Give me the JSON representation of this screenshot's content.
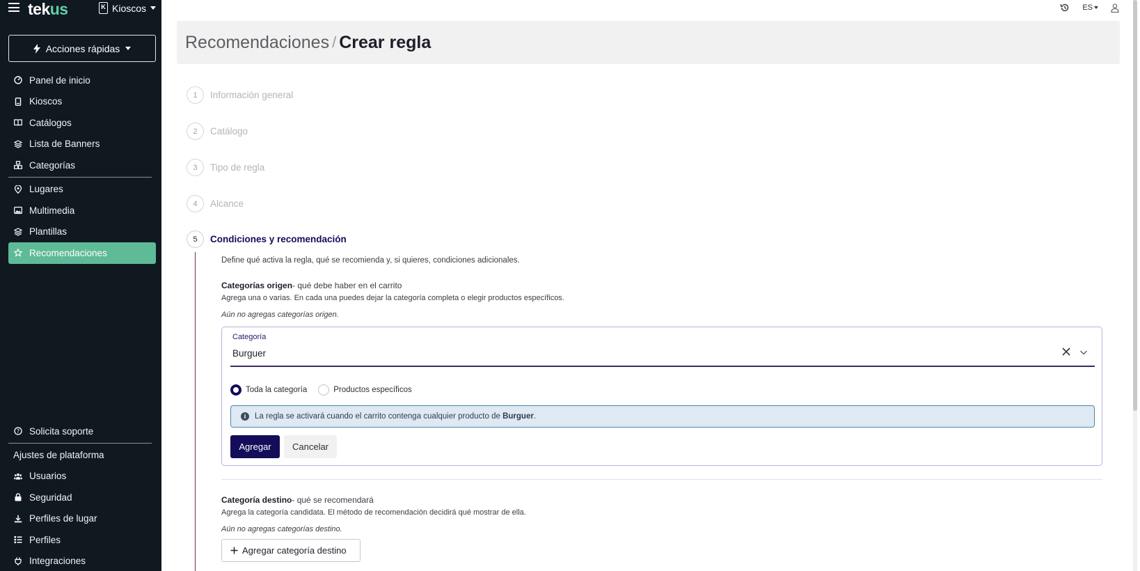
{
  "app": {
    "logo_text_a": "tek",
    "logo_text_b": "us",
    "kiosk_selector": "Kioscos",
    "quick_actions": "Acciones rápidas"
  },
  "sidebar": {
    "items_top": [
      {
        "label": "Panel de inicio",
        "icon": "dashboard-icon"
      },
      {
        "label": "Kioscos",
        "icon": "kiosk-icon"
      },
      {
        "label": "Catálogos",
        "icon": "book-icon"
      },
      {
        "label": "Lista de Banners",
        "icon": "layers-icon"
      },
      {
        "label": "Categorías",
        "icon": "category-icon"
      }
    ],
    "items_mid": [
      {
        "label": "Lugares",
        "icon": "pin-icon"
      },
      {
        "label": "Multimedia",
        "icon": "image-icon"
      },
      {
        "label": "Plantillas",
        "icon": "layers-icon"
      },
      {
        "label": "Recomendaciones",
        "icon": "star-icon",
        "active": true
      }
    ],
    "support": "Solicita soporte",
    "settings_title": "Ajustes de plataforma",
    "items_settings": [
      {
        "label": "Usuarios",
        "icon": "users-icon"
      },
      {
        "label": "Seguridad",
        "icon": "lock-icon"
      },
      {
        "label": "Perfiles de lugar",
        "icon": "anchor-icon"
      },
      {
        "label": "Perfiles",
        "icon": "list-icon"
      },
      {
        "label": "Integraciones",
        "icon": "plug-icon"
      }
    ]
  },
  "topbar": {
    "language": "ES"
  },
  "header": {
    "breadcrumb_parent": "Recomendaciones",
    "separator": "/",
    "breadcrumb_current": "Crear regla"
  },
  "steps": [
    {
      "num": "1",
      "label": "Información general"
    },
    {
      "num": "2",
      "label": "Catálogo"
    },
    {
      "num": "3",
      "label": "Tipo de regla"
    },
    {
      "num": "4",
      "label": "Alcance"
    },
    {
      "num": "5",
      "label": "Condiciones y recomendación",
      "active": true
    }
  ],
  "step5": {
    "description": "Define qué activa la regla, qué se recomienda y, si quieres, condiciones adicionales.",
    "origin_title": "Categorías origen",
    "origin_subtitle": "- qué debe haber en el carrito",
    "origin_help": "Agrega una o varias. En cada una puedes dejar la categoría completa o elegir productos específicos.",
    "origin_empty": "Aún no agregas categorías origen.",
    "form": {
      "field_label": "Categoría",
      "field_value": "Burguer",
      "radio_all": "Toda la categoría",
      "radio_specific": "Productos específicos",
      "info_text_prefix": "La regla se activará cuando el carrito contenga cualquier producto de ",
      "info_text_bold": "Burguer",
      "info_text_suffix": ".",
      "add_button": "Agregar",
      "cancel_button": "Cancelar"
    },
    "dest_title": "Categoría destino",
    "dest_subtitle": "- qué se recomendará",
    "dest_help": "Agrega la categoría candidata. El método de recomendación decidirá qué mostrar de ella.",
    "dest_empty": "Aún no agregas categorías destino.",
    "dest_add_button": "Agregar categoría destino"
  }
}
